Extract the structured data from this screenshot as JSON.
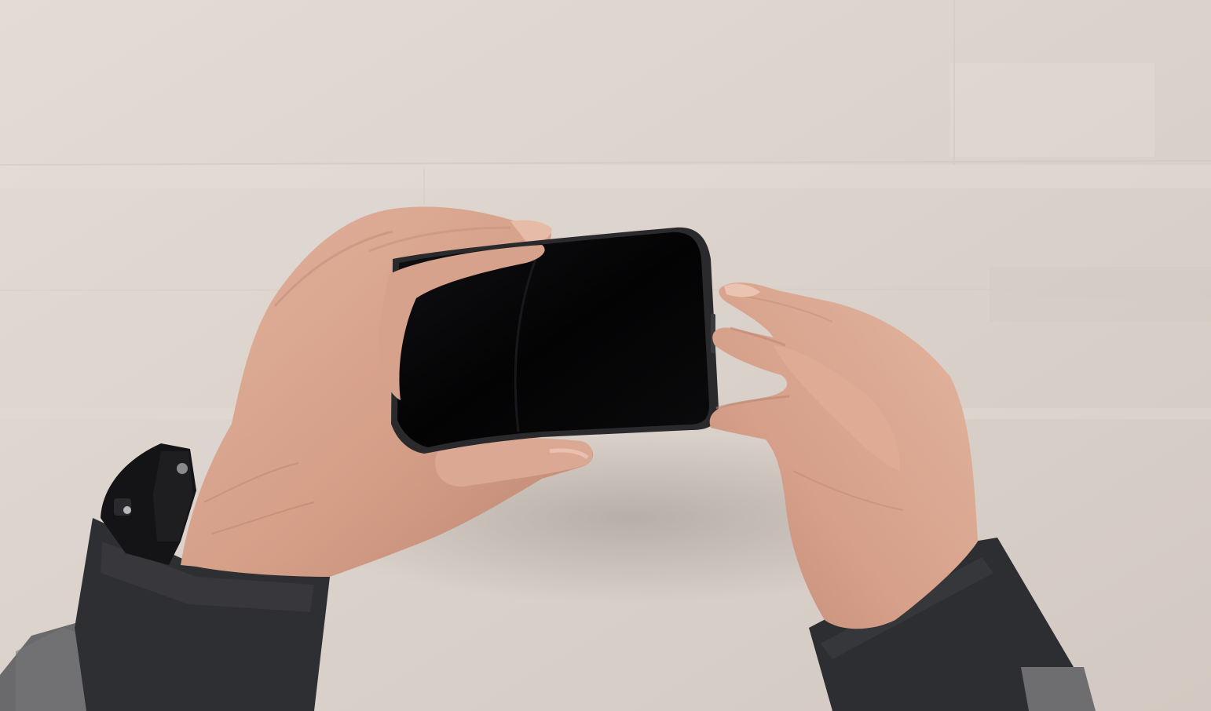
{
  "scene": {
    "description_free": true,
    "colors": {
      "table": "#dbd2cc",
      "table_light": "#e4dcd6",
      "table_dark": "#cfc5be",
      "skin": "#d9a58e",
      "skin_shadow": "#b98370",
      "skin_highlight": "#e8bda8",
      "phone_screen": "#050506",
      "phone_frame": "#2a2a2c",
      "sleeve": "#2f3033",
      "sweater": "#6c6c6e",
      "watch": "#141416"
    },
    "icons": [
      "phone",
      "left-hand",
      "right-hand",
      "wristwatch"
    ]
  }
}
